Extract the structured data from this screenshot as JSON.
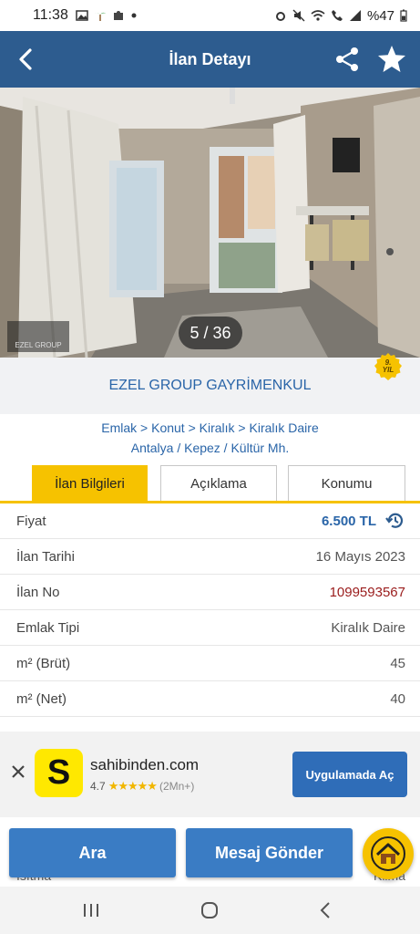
{
  "status_bar": {
    "time": "11:38",
    "battery": "%47",
    "left_icons": [
      "gallery-icon",
      "palm-icon",
      "puzzle-icon",
      "dot-icon"
    ],
    "right_icons": [
      "alarm-icon",
      "mute-icon",
      "wifi-icon",
      "call-icon",
      "signal-icon",
      "battery-icon"
    ]
  },
  "header": {
    "title": "İlan Detayı",
    "background": "#2d5c8f"
  },
  "photo": {
    "counter": "5 / 36",
    "watermark": "EZEL GROUP"
  },
  "store": {
    "name": "EZEL GROUP GAYRİMENKUL",
    "badge_top": "9.",
    "badge_bottom": "YIL"
  },
  "breadcrumbs": {
    "line1": "Emlak > Konut > Kiralık > Kiralık Daire",
    "line2": "Antalya / Kepez / Kültür Mh."
  },
  "tabs": [
    {
      "label": "İlan Bilgileri",
      "active": true
    },
    {
      "label": "Açıklama",
      "active": false
    },
    {
      "label": "Konumu",
      "active": false
    }
  ],
  "details": [
    {
      "label": "Fiyat",
      "value": "6.500 TL"
    },
    {
      "label": "İlan Tarihi",
      "value": "16 Mayıs 2023"
    },
    {
      "label": "İlan No",
      "value": "1099593567"
    },
    {
      "label": "Emlak Tipi",
      "value": "Kiralık Daire"
    },
    {
      "label": "m² (Brüt)",
      "value": "45"
    },
    {
      "label": "m² (Net)",
      "value": "40"
    }
  ],
  "app_banner": {
    "logo_letter": "S",
    "app_name": "sahibinden.com",
    "rating": "4.7",
    "stars": "★★★★★",
    "count": "(2Mn+)",
    "open_label": "Uygulamada Aç"
  },
  "peek_row": {
    "label": "Isıtma",
    "value": "Klima"
  },
  "actions": {
    "call_label": "Ara",
    "message_label": "Mesaj Gönder"
  },
  "colors": {
    "accent_yellow": "#f6c200",
    "link_blue": "#2a65a8",
    "button_blue": "#3a7cc4"
  }
}
